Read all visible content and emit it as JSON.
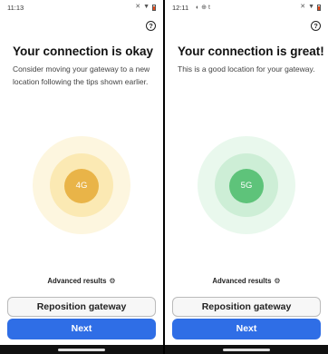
{
  "screens": [
    {
      "status_time": "11:13",
      "status_extra": "",
      "title": "Your connection is okay",
      "subtitle": "Consider moving your gateway to a new location following the tips shown earlier.",
      "network": "4G",
      "colors": {
        "outer": "#fdf6df",
        "middle": "#fbe9b3",
        "inner": "#e9b448"
      },
      "advanced_label": "Advanced results",
      "secondary_button": "Reposition gateway",
      "primary_button": "Next"
    },
    {
      "status_time": "12:11",
      "status_extra": "◐  ⊕  t",
      "title": "Your connection is great!",
      "subtitle": "This is a good location for your gateway.",
      "network": "5G",
      "colors": {
        "outer": "#e9f8ed",
        "middle": "#cdeed6",
        "inner": "#5ec37a"
      },
      "advanced_label": "Advanced results",
      "secondary_button": "Reposition gateway",
      "primary_button": "Next"
    }
  ],
  "icons": {
    "help": "help-icon",
    "advanced": "settings-icon",
    "wifi": "wifi-icon",
    "mute": "mute-icon",
    "battery": "battery-icon"
  }
}
